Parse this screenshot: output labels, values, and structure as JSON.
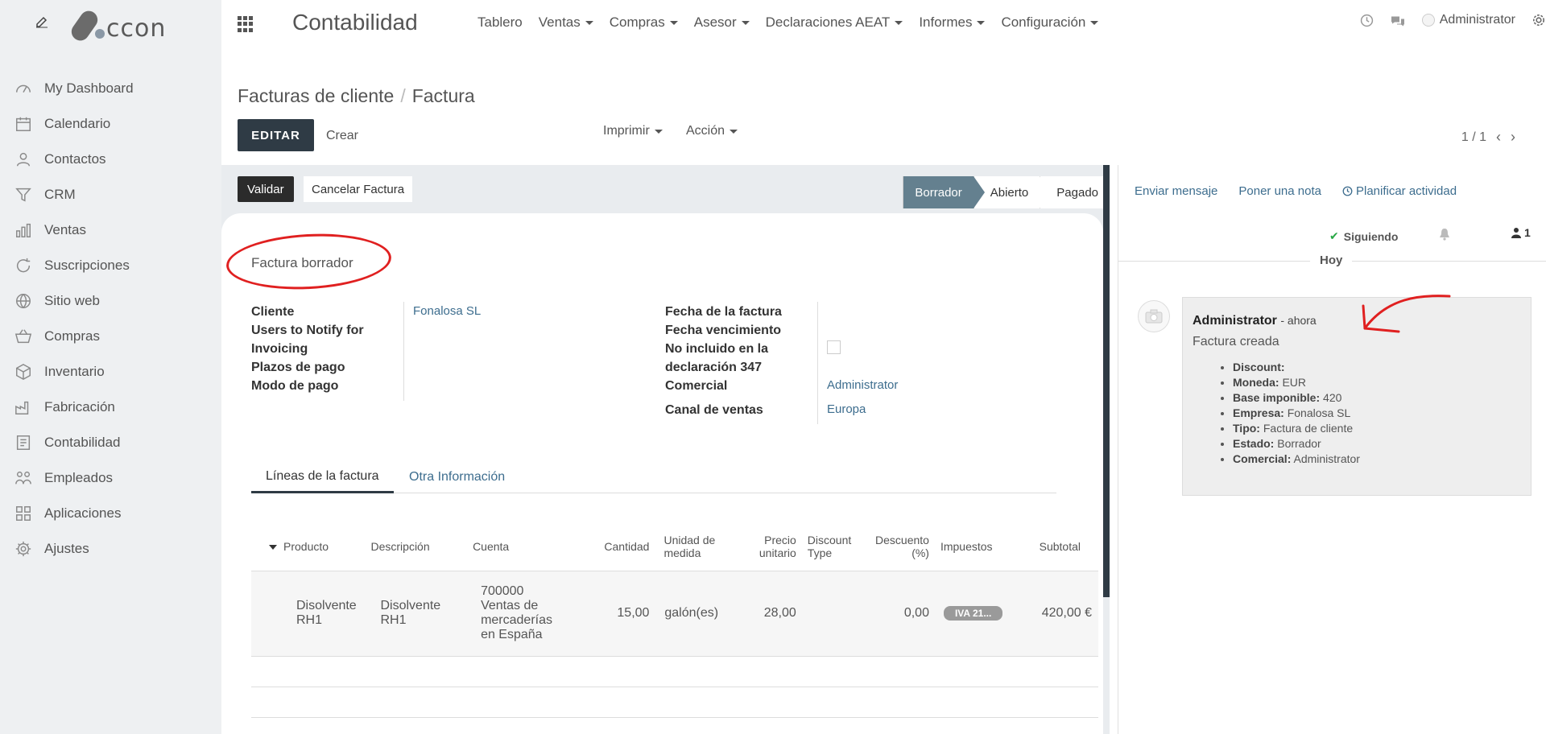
{
  "sidebar": {
    "items": [
      {
        "label": "My Dashboard",
        "icon": "dashboard-icon"
      },
      {
        "label": "Calendario",
        "icon": "calendar-icon"
      },
      {
        "label": "Contactos",
        "icon": "contacts-icon"
      },
      {
        "label": "CRM",
        "icon": "funnel-icon"
      },
      {
        "label": "Ventas",
        "icon": "bar-chart-icon"
      },
      {
        "label": "Suscripciones",
        "icon": "refresh-icon"
      },
      {
        "label": "Sitio web",
        "icon": "globe-icon"
      },
      {
        "label": "Compras",
        "icon": "basket-icon"
      },
      {
        "label": "Inventario",
        "icon": "box-icon"
      },
      {
        "label": "Fabricación",
        "icon": "factory-icon"
      },
      {
        "label": "Contabilidad",
        "icon": "invoice-icon"
      },
      {
        "label": "Empleados",
        "icon": "people-icon"
      },
      {
        "label": "Aplicaciones",
        "icon": "apps-icon"
      },
      {
        "label": "Ajustes",
        "icon": "gear-icon"
      }
    ]
  },
  "logo": {
    "text": "ccon"
  },
  "topbar": {
    "app_title": "Contabilidad",
    "nav": [
      "Tablero",
      "Ventas",
      "Compras",
      "Asesor",
      "Declaraciones AEAT",
      "Informes",
      "Configuración"
    ],
    "user": "Administrator"
  },
  "control": {
    "breadcrumb_parent": "Facturas de cliente",
    "breadcrumb_sep": "/",
    "breadcrumb_current": "Factura",
    "edit_label": "EDITAR",
    "create_label": "Crear",
    "print_label": "Imprimir",
    "action_label": "Acción",
    "pager": "1 / 1"
  },
  "statusbar": {
    "validate_label": "Validar",
    "cancel_label": "Cancelar Factura",
    "states": [
      "Borrador",
      "Abierto",
      "Pagado"
    ],
    "active_state": "Borrador"
  },
  "form": {
    "title": "Factura borrador",
    "left_fields": {
      "cliente_label": "Cliente",
      "cliente_value": "Fonalosa SL",
      "notify_label_1": "Users to Notify for",
      "notify_label_2": "Invoicing",
      "plazos_label": "Plazos de pago",
      "modo_label": "Modo de pago"
    },
    "right_fields": {
      "fecha_label": "Fecha de la factura",
      "vencimiento_label": "Fecha vencimiento",
      "no347_label_1": "No incluido en la",
      "no347_label_2": "declaración 347",
      "comercial_label": "Comercial",
      "comercial_value": "Administrator",
      "canal_label": "Canal de ventas",
      "canal_value": "Europa"
    },
    "tabs": [
      "Líneas de la factura",
      "Otra Información"
    ],
    "table": {
      "headers": {
        "producto": "Producto",
        "descripcion": "Descripción",
        "cuenta": "Cuenta",
        "cantidad": "Cantidad",
        "unidad_1": "Unidad de",
        "unidad_2": "medida",
        "precio_1": "Precio",
        "precio_2": "unitario",
        "disc_type_1": "Discount",
        "disc_type_2": "Type",
        "descuento_1": "Descuento",
        "descuento_2": "(%)",
        "impuestos": "Impuestos",
        "subtotal": "Subtotal"
      },
      "rows": [
        {
          "producto_1": "Disolvente",
          "producto_2": "RH1",
          "descripcion_1": "Disolvente",
          "descripcion_2": "RH1",
          "cuenta_1": "700000",
          "cuenta_2": "Ventas de",
          "cuenta_3": "mercaderías",
          "cuenta_4": "en España",
          "cantidad": "15,00",
          "unidad": "galón(es)",
          "precio": "28,00",
          "disc_type": "",
          "descuento": "0,00",
          "impuesto": "IVA 21...",
          "subtotal": "420,00 €"
        }
      ]
    }
  },
  "chatter": {
    "send_message": "Enviar mensaje",
    "log_note": "Poner una nota",
    "schedule": "Planificar actividad",
    "following": "Siguiendo",
    "followers_count": "1",
    "today": "Hoy",
    "message": {
      "author": "Administrator",
      "date": "- ahora",
      "body": "Factura creada",
      "tracking": [
        {
          "label": "Discount:",
          "value": ""
        },
        {
          "label": "Moneda:",
          "value": "EUR"
        },
        {
          "label": "Base imponible:",
          "value": "420"
        },
        {
          "label": "Empresa:",
          "value": "Fonalosa SL"
        },
        {
          "label": "Tipo:",
          "value": "Factura de cliente"
        },
        {
          "label": "Estado:",
          "value": "Borrador"
        },
        {
          "label": "Comercial:",
          "value": "Administrator"
        }
      ]
    }
  },
  "colors": {
    "primary_dark": "#2f3b45",
    "state_active": "#64808f",
    "link": "#3d6d8e",
    "annotation_red": "#e02020"
  }
}
